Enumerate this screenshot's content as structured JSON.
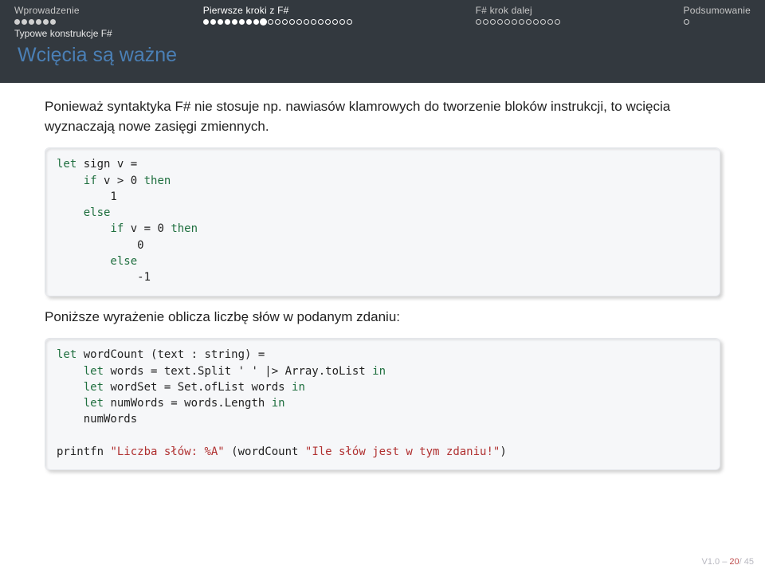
{
  "nav": {
    "sections": [
      {
        "label": "Wprowadzenie",
        "total": 6,
        "filled": 6,
        "current": false
      },
      {
        "label": "Pierwsze kroki z F#",
        "total": 21,
        "filled": 8,
        "here": 9,
        "current": true
      },
      {
        "label": "F# krok dalej",
        "total": 12,
        "filled": 0,
        "current": false
      },
      {
        "label": "Podsumowanie",
        "total": 1,
        "filled": 0,
        "current": false
      }
    ],
    "subsection": "Typowe konstrukcje F#"
  },
  "title": "Wcięcia są ważne",
  "paragraph1": "Ponieważ syntaktyka F# nie stosuje np. nawiasów klamrowych do tworzenie bloków instrukcji, to wcięcia wyznaczają nowe zasięgi zmiennych.",
  "code1": {
    "l1a": "let",
    "l1b": " sign v =",
    "l2a": "    if",
    "l2b": " v > 0 ",
    "l2c": "then",
    "l3": "        1",
    "l4": "    else",
    "l5a": "        if",
    "l5b": " v = 0 ",
    "l5c": "then",
    "l6": "            0",
    "l7": "        else",
    "l8": "            -1"
  },
  "paragraph2": "Poniższe wyrażenie oblicza liczbę słów w podanym zdaniu:",
  "code2": {
    "l1a": "let",
    "l1b": " wordCount (text : string) =",
    "l2a": "    let",
    "l2b": " words = text.Split ' ' |> Array.toList ",
    "l2c": "in",
    "l3a": "    let",
    "l3b": " wordSet = Set.ofList words ",
    "l3c": "in",
    "l4a": "    let",
    "l4b": " numWords = words.Length ",
    "l4c": "in",
    "l5": "    numWords",
    "blank": "",
    "l6a": "printfn ",
    "l6b": "\"Liczba słów: %A\"",
    "l6c": " (wordCount ",
    "l6d": "\"Ile słów jest w tym zdaniu!\"",
    "l6e": ")"
  },
  "footer": {
    "ver": "V1.0 – ",
    "cur": "20",
    "sep": "/ ",
    "tot": "45"
  }
}
